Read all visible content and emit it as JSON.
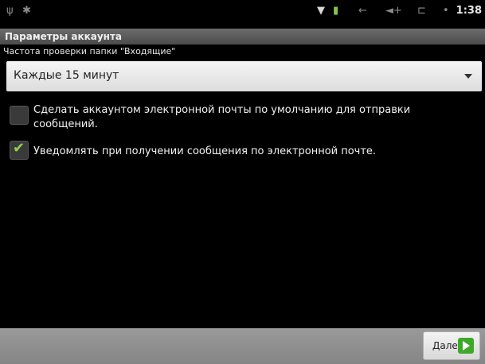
{
  "status_bar": {
    "icons": [
      "usb-icon",
      "android-icon",
      "wifi-icon",
      "battery-icon",
      "back-icon",
      "volume-icon",
      "signal-icon",
      "dot-icon"
    ],
    "time": "1:38"
  },
  "title_bar": {
    "title": "Параметры аккаунта"
  },
  "frequency": {
    "label": "Частота проверки папки \"Входящие\"",
    "selected": "Каждые 15 минут"
  },
  "options": {
    "default_account": {
      "label": "Сделать аккаунтом электронной почты по умолчанию для отправки сообщений.",
      "checked": false
    },
    "notify": {
      "label": "Уведомлять при получении сообщения по электронной почте.",
      "checked": true
    }
  },
  "bottom_bar": {
    "next_label": "Далее"
  },
  "colors": {
    "accent_green": "#3fa82a",
    "check_green": "#8fd14f"
  }
}
